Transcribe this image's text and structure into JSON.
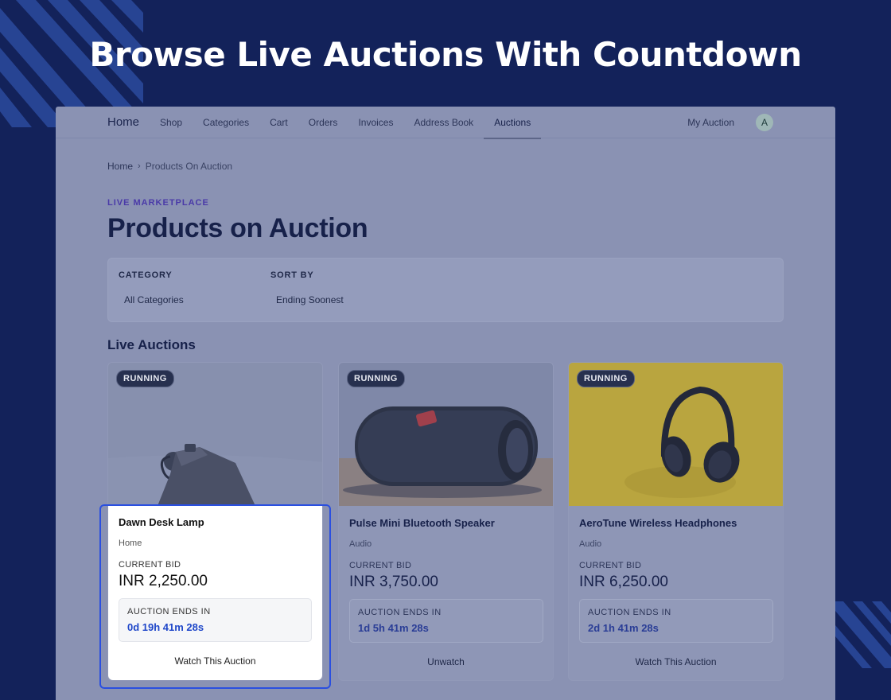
{
  "hero": {
    "title": "Browse Live Auctions With Countdown"
  },
  "nav": {
    "brand": "Home",
    "items": [
      {
        "label": "Shop"
      },
      {
        "label": "Categories"
      },
      {
        "label": "Cart"
      },
      {
        "label": "Orders"
      },
      {
        "label": "Invoices"
      },
      {
        "label": "Address Book"
      },
      {
        "label": "Auctions",
        "active": true
      }
    ],
    "my_auction": "My Auction",
    "avatar_initial": "A"
  },
  "breadcrumb": {
    "home": "Home",
    "separator": "›",
    "current": "Products On Auction"
  },
  "page": {
    "eyebrow": "LIVE MARKETPLACE",
    "title": "Products on Auction"
  },
  "filters": {
    "category_label": "CATEGORY",
    "category_value": "All Categories",
    "sort_label": "SORT BY",
    "sort_value": "Ending Soonest"
  },
  "section_title": "Live Auctions",
  "auctions": [
    {
      "status": "RUNNING",
      "name": "Dawn Desk Lamp",
      "category": "Home",
      "bid_label": "CURRENT BID",
      "bid": "INR 2,250.00",
      "ends_label": "AUCTION ENDS IN",
      "ends": "0d 19h 41m 28s",
      "action": "Watch This Auction",
      "image_icon": "desk-lamp-photo"
    },
    {
      "status": "RUNNING",
      "name": "Pulse Mini Bluetooth Speaker",
      "category": "Audio",
      "bid_label": "CURRENT BID",
      "bid": "INR 3,750.00",
      "ends_label": "AUCTION ENDS IN",
      "ends": "1d 5h 41m 28s",
      "action": "Unwatch",
      "image_icon": "speaker-photo"
    },
    {
      "status": "RUNNING",
      "name": "AeroTune Wireless Headphones",
      "category": "Audio",
      "bid_label": "CURRENT BID",
      "bid": "INR 6,250.00",
      "ends_label": "AUCTION ENDS IN",
      "ends": "2d 1h 41m 28s",
      "action": "Watch This Auction",
      "image_icon": "headphones-photo"
    }
  ],
  "colors": {
    "background": "#13225a",
    "overlay": "#8a92b3",
    "accent": "#2a4fe0",
    "countdown": "#1f47c9",
    "eyebrow": "#4a3aa8"
  }
}
